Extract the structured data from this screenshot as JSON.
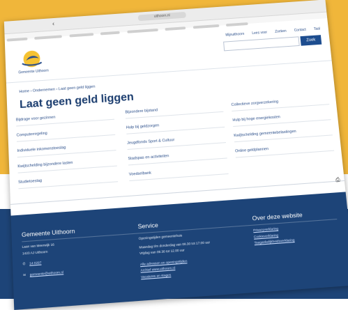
{
  "browser": {
    "address": "uithoorn.nl"
  },
  "header": {
    "logo_text": "Gemeente Uithoorn",
    "links": [
      "Mijnuithoorn",
      "Lees voor",
      "Zoeken",
      "Contact",
      "Taal"
    ],
    "search_button": "Zoek"
  },
  "breadcrumb": "Home › Ondernemen › Laat geen geld liggen",
  "page_title": "Laat geen geld liggen",
  "links": {
    "col1": [
      "Bijdrage voor gezinnen",
      "Computerregeling",
      "Individuele inkomenstoeslag",
      "Kwijtschelding bijzondere lasten",
      "Studietoeslag"
    ],
    "col2": [
      "Bijzondere bijstand",
      "Hulp bij geldzorgen",
      "Jeugdfonds Sport & Cultuur",
      "Stadspas en activiteiten",
      "Voedselbank"
    ],
    "col3": [
      "Collectieve zorgverzekering",
      "Hulp bij hoge energiekosten",
      "Kwijtschelding gemeentebelastingen",
      "Online geldplannen"
    ]
  },
  "footer": {
    "col1": {
      "heading": "Gemeente Uithoorn",
      "address_line1": "Laan van Meerwijk 16",
      "address_line2": "1423 AJ Uithoorn",
      "phone": "14 0297",
      "email": "gemeente@uithoorn.nl"
    },
    "col2": {
      "heading": "Service",
      "subheading": "Openingstijden gemeentehuis",
      "hours1": "Maandag t/m donderdag van 08.30 tot 17.00 uur",
      "hours2": "Vrijdag van 08.30 tot 12.00 uur",
      "links": [
        "Alle adressen en openingstijden",
        "Archief www.uithoorn.nl",
        "Vacatures en stages"
      ]
    },
    "col3": {
      "heading": "Over deze website",
      "links": [
        "Privacyverklaring",
        "Cookieverklaring",
        "Toegankelijkheidsverklaring"
      ]
    }
  },
  "colors": {
    "brand_blue": "#1d4478",
    "accent_orange": "#f0b63a",
    "link_blue": "#2a4e8a"
  }
}
